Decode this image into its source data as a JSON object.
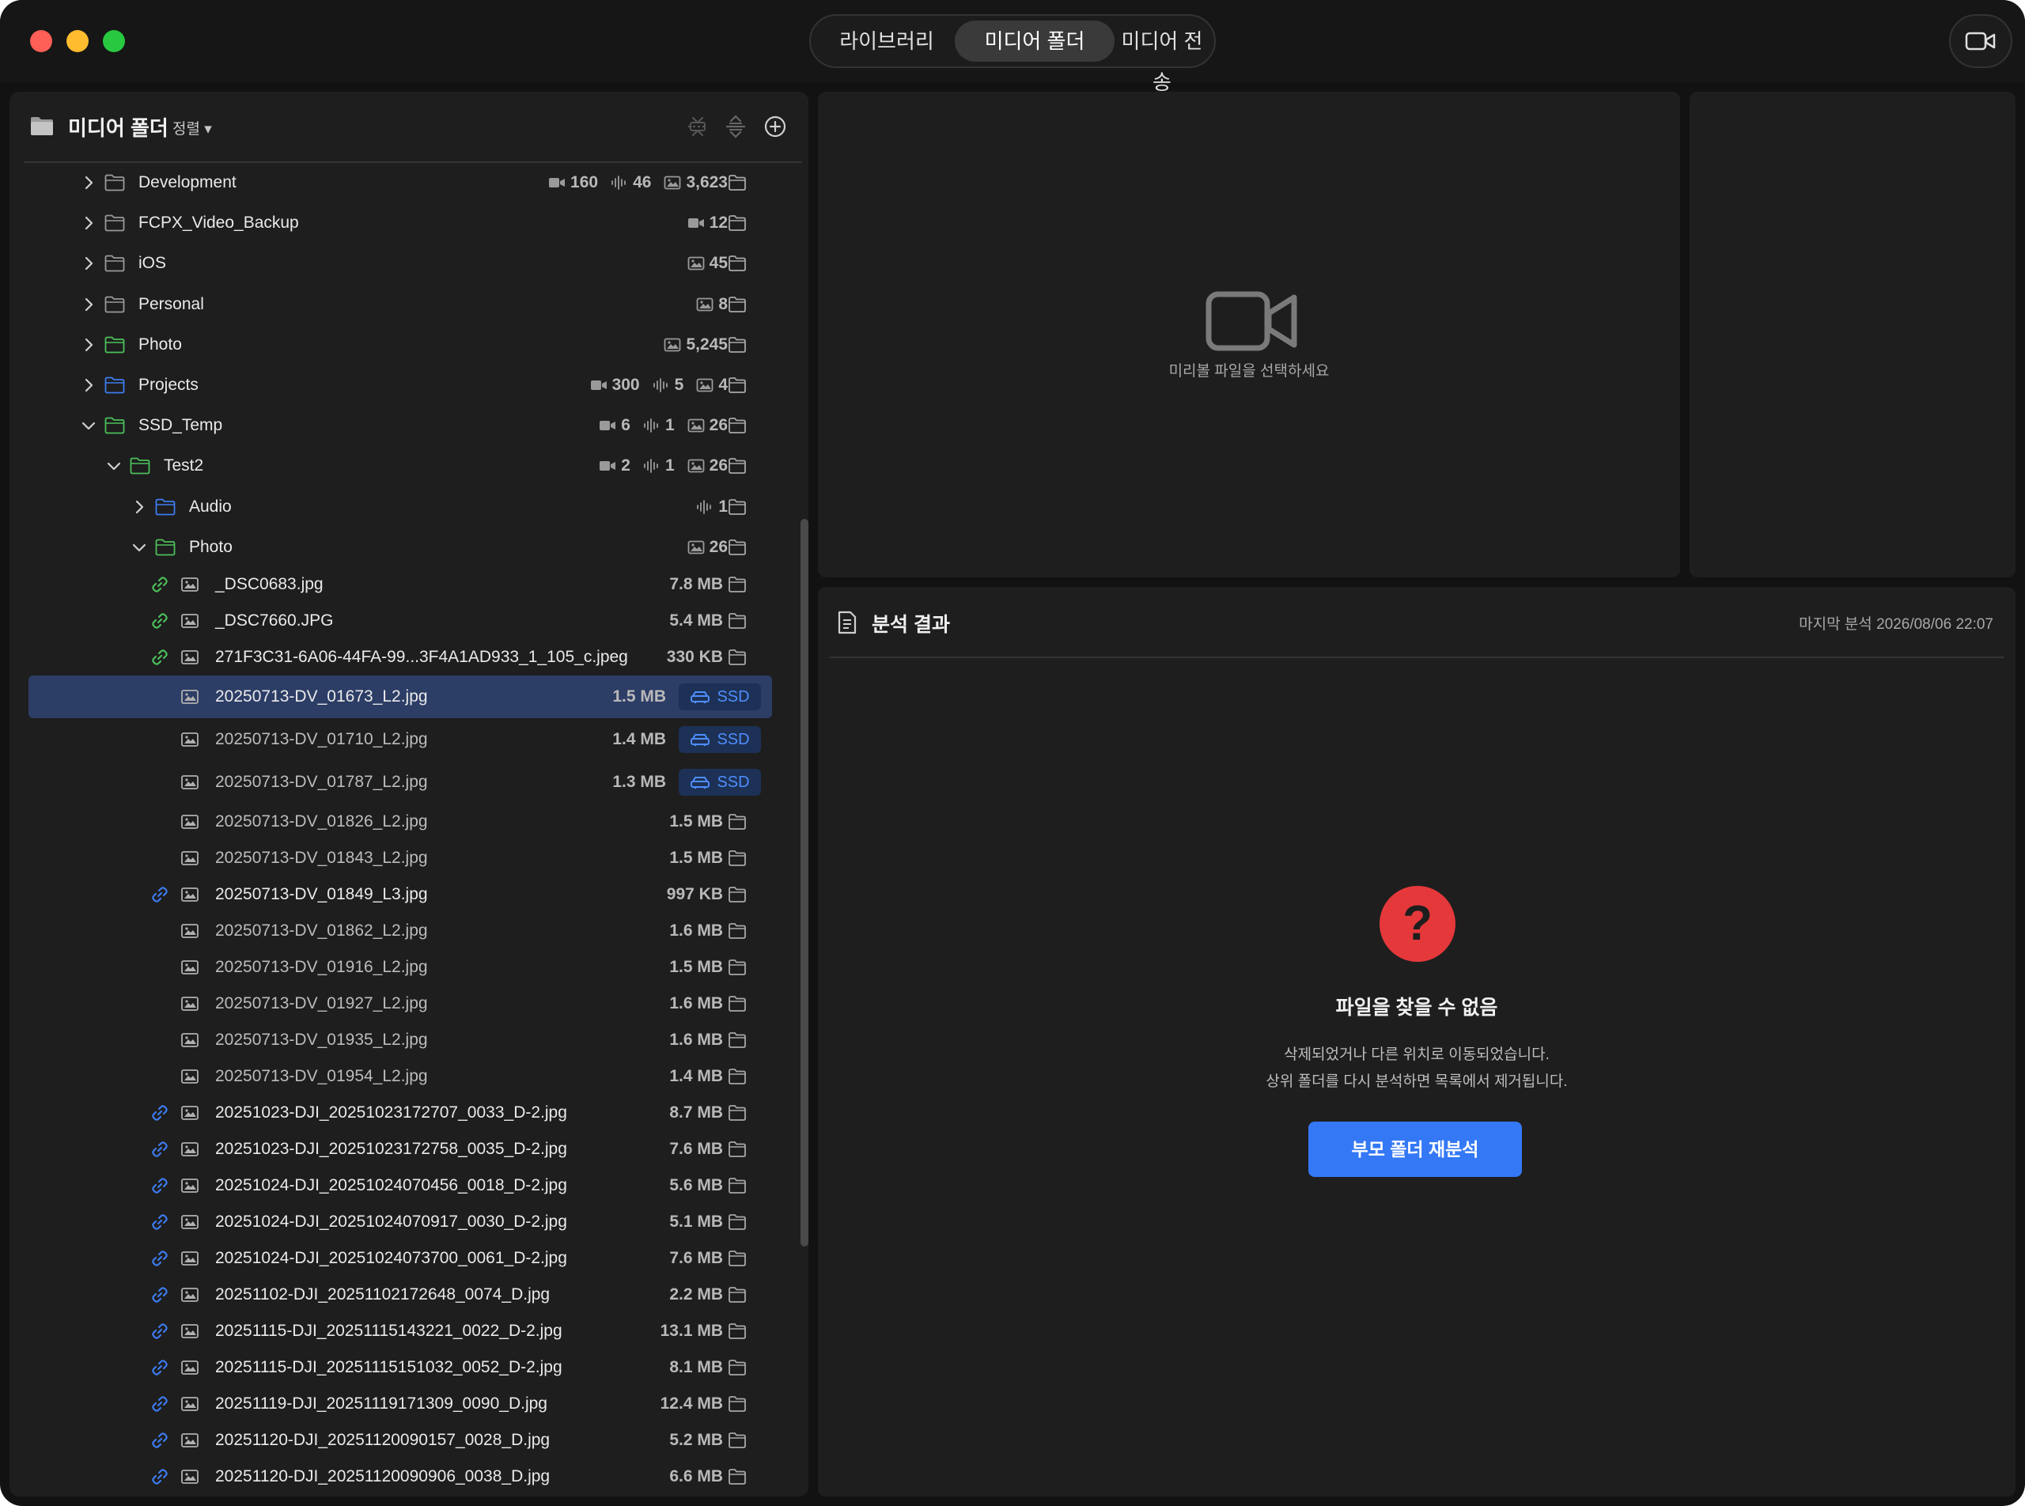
{
  "tabs": [
    {
      "label": "라이브러리",
      "active": false
    },
    {
      "label": "미디어 폴더",
      "active": true
    },
    {
      "label": "미디어 전송",
      "active": false
    }
  ],
  "left_panel": {
    "title": "미디어 폴더",
    "sort_label": "정렬 ▾",
    "folders": [
      {
        "name": "Development",
        "depth": 0,
        "expanded": false,
        "color": "#9a9a9a",
        "stats": [
          {
            "icon": "video-icon",
            "value": "160"
          },
          {
            "icon": "audio-icon",
            "value": "46"
          },
          {
            "icon": "image-icon",
            "value": "3,623"
          }
        ]
      },
      {
        "name": "FCPX_Video_Backup",
        "depth": 0,
        "expanded": false,
        "color": "#9a9a9a",
        "stats": [
          {
            "icon": "video-icon",
            "value": "12"
          }
        ]
      },
      {
        "name": "iOS",
        "depth": 0,
        "expanded": false,
        "color": "#9a9a9a",
        "stats": [
          {
            "icon": "image-icon",
            "value": "45"
          }
        ]
      },
      {
        "name": "Personal",
        "depth": 0,
        "expanded": false,
        "color": "#9a9a9a",
        "stats": [
          {
            "icon": "image-icon",
            "value": "8"
          }
        ]
      },
      {
        "name": "Photo",
        "depth": 0,
        "expanded": false,
        "color": "#4cc05a",
        "stats": [
          {
            "icon": "image-icon",
            "value": "5,245"
          }
        ]
      },
      {
        "name": "Projects",
        "depth": 0,
        "expanded": false,
        "color": "#3d7cf0",
        "stats": [
          {
            "icon": "video-icon",
            "value": "300"
          },
          {
            "icon": "audio-icon",
            "value": "5"
          },
          {
            "icon": "image-icon",
            "value": "4"
          }
        ]
      },
      {
        "name": "SSD_Temp",
        "depth": 0,
        "expanded": true,
        "color": "#4cc05a",
        "stats": [
          {
            "icon": "video-icon",
            "value": "6"
          },
          {
            "icon": "audio-icon",
            "value": "1"
          },
          {
            "icon": "image-icon",
            "value": "26"
          }
        ]
      },
      {
        "name": "Test2",
        "depth": 1,
        "expanded": true,
        "color": "#4cc05a",
        "stats": [
          {
            "icon": "video-icon",
            "value": "2"
          },
          {
            "icon": "audio-icon",
            "value": "1"
          },
          {
            "icon": "image-icon",
            "value": "26"
          }
        ]
      },
      {
        "name": "Audio",
        "depth": 2,
        "expanded": false,
        "color": "#3d7cf0",
        "stats": [
          {
            "icon": "audio-icon",
            "value": "1"
          }
        ]
      },
      {
        "name": "Photo",
        "depth": 2,
        "expanded": true,
        "color": "#4cc05a",
        "stats": [
          {
            "icon": "image-icon",
            "value": "26"
          }
        ]
      }
    ],
    "files": [
      {
        "name": "_DSC0683.jpg",
        "size": "7.8 MB",
        "link": "green",
        "badge": "",
        "selected": false,
        "bright": true
      },
      {
        "name": "_DSC7660.JPG",
        "size": "5.4 MB",
        "link": "green",
        "badge": "",
        "selected": false,
        "bright": true
      },
      {
        "name": "271F3C31-6A06-44FA-99...3F4A1AD933_1_105_c.jpeg",
        "size": "330 KB",
        "link": "green",
        "badge": "",
        "selected": false,
        "bright": true
      },
      {
        "name": "20250713-DV_01673_L2.jpg",
        "size": "1.5 MB",
        "link": "",
        "badge": "SSD",
        "selected": true,
        "bright": false
      },
      {
        "name": "20250713-DV_01710_L2.jpg",
        "size": "1.4 MB",
        "link": "",
        "badge": "SSD",
        "selected": false,
        "bright": false
      },
      {
        "name": "20250713-DV_01787_L2.jpg",
        "size": "1.3 MB",
        "link": "",
        "badge": "SSD",
        "selected": false,
        "bright": false
      },
      {
        "name": "20250713-DV_01826_L2.jpg",
        "size": "1.5 MB",
        "link": "",
        "badge": "",
        "selected": false,
        "bright": false
      },
      {
        "name": "20250713-DV_01843_L2.jpg",
        "size": "1.5 MB",
        "link": "",
        "badge": "",
        "selected": false,
        "bright": false
      },
      {
        "name": "20250713-DV_01849_L3.jpg",
        "size": "997 KB",
        "link": "blue",
        "badge": "",
        "selected": false,
        "bright": true
      },
      {
        "name": "20250713-DV_01862_L2.jpg",
        "size": "1.6 MB",
        "link": "",
        "badge": "",
        "selected": false,
        "bright": false
      },
      {
        "name": "20250713-DV_01916_L2.jpg",
        "size": "1.5 MB",
        "link": "",
        "badge": "",
        "selected": false,
        "bright": false
      },
      {
        "name": "20250713-DV_01927_L2.jpg",
        "size": "1.6 MB",
        "link": "",
        "badge": "",
        "selected": false,
        "bright": false
      },
      {
        "name": "20250713-DV_01935_L2.jpg",
        "size": "1.6 MB",
        "link": "",
        "badge": "",
        "selected": false,
        "bright": false
      },
      {
        "name": "20250713-DV_01954_L2.jpg",
        "size": "1.4 MB",
        "link": "",
        "badge": "",
        "selected": false,
        "bright": false
      },
      {
        "name": "20251023-DJI_20251023172707_0033_D-2.jpg",
        "size": "8.7 MB",
        "link": "blue",
        "badge": "",
        "selected": false,
        "bright": true
      },
      {
        "name": "20251023-DJI_20251023172758_0035_D-2.jpg",
        "size": "7.6 MB",
        "link": "blue",
        "badge": "",
        "selected": false,
        "bright": true
      },
      {
        "name": "20251024-DJI_20251024070456_0018_D-2.jpg",
        "size": "5.6 MB",
        "link": "blue",
        "badge": "",
        "selected": false,
        "bright": true
      },
      {
        "name": "20251024-DJI_20251024070917_0030_D-2.jpg",
        "size": "5.1 MB",
        "link": "blue",
        "badge": "",
        "selected": false,
        "bright": true
      },
      {
        "name": "20251024-DJI_20251024073700_0061_D-2.jpg",
        "size": "7.6 MB",
        "link": "blue",
        "badge": "",
        "selected": false,
        "bright": true
      },
      {
        "name": "20251102-DJI_20251102172648_0074_D.jpg",
        "size": "2.2 MB",
        "link": "blue",
        "badge": "",
        "selected": false,
        "bright": true
      },
      {
        "name": "20251115-DJI_20251115143221_0022_D-2.jpg",
        "size": "13.1 MB",
        "link": "blue",
        "badge": "",
        "selected": false,
        "bright": true
      },
      {
        "name": "20251115-DJI_20251115151032_0052_D-2.jpg",
        "size": "8.1 MB",
        "link": "blue",
        "badge": "",
        "selected": false,
        "bright": true
      },
      {
        "name": "20251119-DJI_20251119171309_0090_D.jpg",
        "size": "12.4 MB",
        "link": "blue",
        "badge": "",
        "selected": false,
        "bright": true
      },
      {
        "name": "20251120-DJI_20251120090157_0028_D.jpg",
        "size": "5.2 MB",
        "link": "blue",
        "badge": "",
        "selected": false,
        "bright": true
      },
      {
        "name": "20251120-DJI_20251120090906_0038_D.jpg",
        "size": "6.6 MB",
        "link": "blue",
        "badge": "",
        "selected": false,
        "bright": true
      }
    ]
  },
  "preview": {
    "placeholder": "미리볼 파일을 선택하세요"
  },
  "analysis": {
    "title": "분석 결과",
    "last_analysis": "마지막 분석 2026/08/06 22:07",
    "error_icon": "?",
    "error_title": "파일을 찾을 수 없음",
    "error_line1": "삭제되었거나 다른 위치로 이동되었습니다.",
    "error_line2": "상위 폴더를 다시 분석하면 목록에서 제거됩니다.",
    "rescan_button": "부모 폴더 재분석"
  },
  "colors": {
    "accent": "#3478f6",
    "link_green": "#4cc05a",
    "link_blue": "#3d7cf0",
    "error_red": "#e5383b"
  }
}
